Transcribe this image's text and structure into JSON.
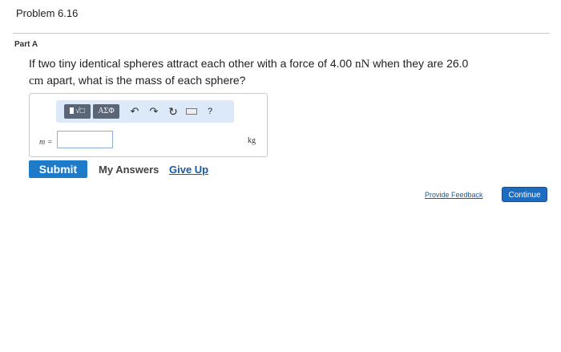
{
  "header": {
    "problem_title": "Problem 6.16"
  },
  "part": {
    "label": "Part A"
  },
  "question": {
    "text_1": "If two tiny identical spheres attract each other with a force of 4.00 ",
    "force_unit": "nN",
    "text_2": " when they are 26.0",
    "distance_unit": "cm",
    "text_3": " apart, what is the mass of each sphere?"
  },
  "toolbar": {
    "templates_label": "√□",
    "symbols_label": "ΑΣΦ",
    "undo_glyph": "↶",
    "redo_glyph": "↷",
    "reset_glyph": "↻",
    "help_glyph": "?"
  },
  "answer": {
    "variable_label": "m =",
    "input_value": "",
    "unit": "kg"
  },
  "actions": {
    "submit_label": "Submit",
    "my_answers_label": "My Answers",
    "give_up_label": "Give Up"
  },
  "footer": {
    "provide_feedback_label": "Provide Feedback",
    "continue_label": "Continue"
  },
  "colors": {
    "primary_button": "#1e7bc9",
    "link": "#1a5aa0",
    "toolbar_bg": "#dbe9f8",
    "toolbar_button": "#5a6576"
  }
}
